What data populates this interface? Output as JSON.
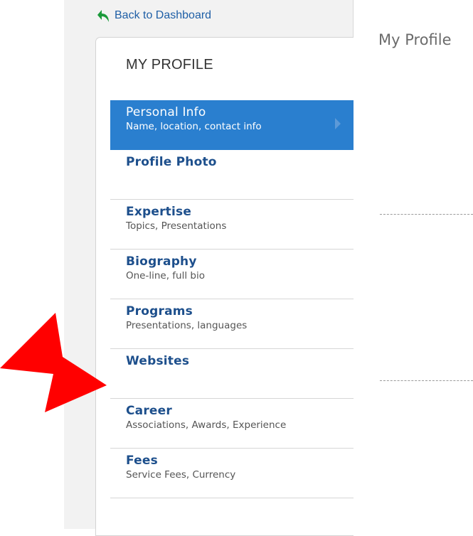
{
  "back_link": {
    "label": "Back to Dashboard",
    "icon": "green-curved-arrow-icon"
  },
  "panel": {
    "title": "MY PROFILE"
  },
  "menu": [
    {
      "label": "Personal Info",
      "sub": "Name, location, contact info",
      "active": true
    },
    {
      "label": "Profile Photo",
      "sub": ""
    },
    {
      "label": "Expertise",
      "sub": "Topics, Presentations"
    },
    {
      "label": "Biography",
      "sub": "One-line, full bio"
    },
    {
      "label": "Programs",
      "sub": "Presentations, languages"
    },
    {
      "label": "Websites",
      "sub": ""
    },
    {
      "label": "Career",
      "sub": "Associations, Awards, Experience"
    },
    {
      "label": "Fees",
      "sub": "Service Fees, Currency"
    }
  ],
  "main": {
    "title": "My Profile"
  },
  "colors": {
    "active": "#2a7fcf",
    "link": "#1f5fa6",
    "label": "#1d4f8c",
    "annotation_arrow": "#ff0000"
  }
}
